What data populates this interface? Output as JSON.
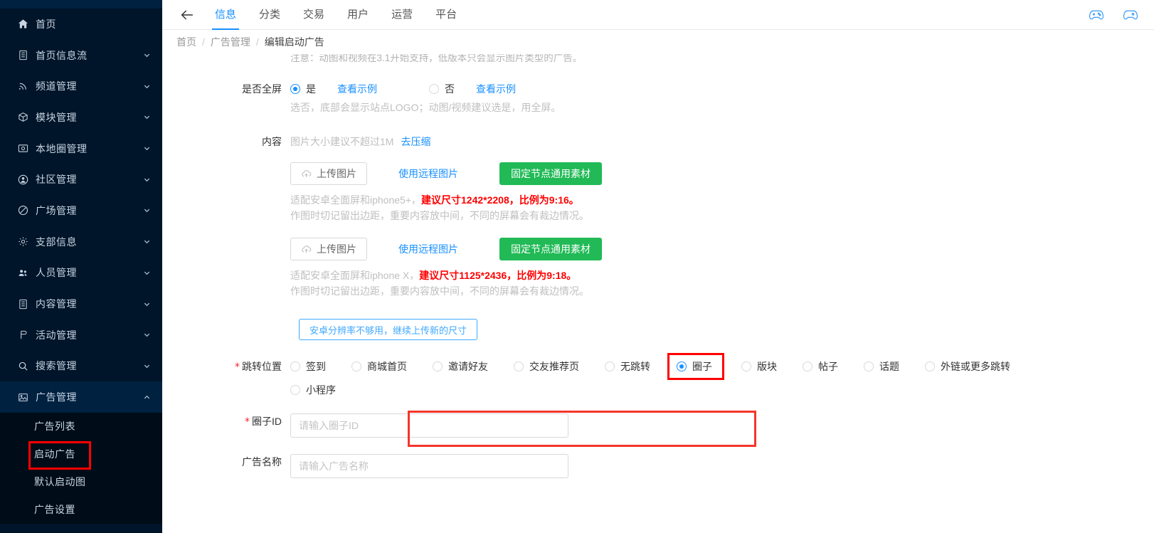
{
  "sidebar": {
    "items": [
      {
        "label": "首页",
        "icon": "home-icon",
        "arrow": false
      },
      {
        "label": "首页信息流",
        "icon": "feed-icon",
        "arrow": true
      },
      {
        "label": "频道管理",
        "icon": "rss-icon",
        "arrow": true
      },
      {
        "label": "模块管理",
        "icon": "cube-icon",
        "arrow": true
      },
      {
        "label": "本地圈管理",
        "icon": "card-icon",
        "arrow": true
      },
      {
        "label": "社区管理",
        "icon": "user-circle-icon",
        "arrow": true
      },
      {
        "label": "广场管理",
        "icon": "slash-circle-icon",
        "arrow": true
      },
      {
        "label": "支部信息",
        "icon": "gear-icon",
        "arrow": true
      },
      {
        "label": "人员管理",
        "icon": "people-icon",
        "arrow": true
      },
      {
        "label": "内容管理",
        "icon": "doc-icon",
        "arrow": true
      },
      {
        "label": "活动管理",
        "icon": "flag-icon",
        "arrow": true
      },
      {
        "label": "搜索管理",
        "icon": "search-icon",
        "arrow": true
      },
      {
        "label": "广告管理",
        "icon": "picture-icon",
        "arrow": true,
        "expanded": true
      }
    ],
    "submenu": [
      {
        "label": "广告列表",
        "highlighted": false
      },
      {
        "label": "启动广告",
        "highlighted": true
      },
      {
        "label": "默认启动图",
        "highlighted": false
      },
      {
        "label": "广告设置",
        "highlighted": false
      }
    ]
  },
  "topnav": {
    "back_icon": "back-arrow-icon",
    "tabs": [
      {
        "label": "信息",
        "active": true
      },
      {
        "label": "分类",
        "active": false
      },
      {
        "label": "交易",
        "active": false
      },
      {
        "label": "用户",
        "active": false
      },
      {
        "label": "运营",
        "active": false
      },
      {
        "label": "平台",
        "active": false
      }
    ],
    "right_icons": [
      "gamepad-icon",
      "gamepad-alt-icon"
    ]
  },
  "breadcrumb": {
    "items": [
      "首页",
      "广告管理",
      "编辑启动广告"
    ],
    "separator": "/"
  },
  "form": {
    "top_note": "注意：动图和视频在3.1开始支持，低版本只会显示图片类型的广告。",
    "fullscreen": {
      "label": "是否全屏",
      "yes_label": "是",
      "yes_link": "查看示例",
      "no_label": "否",
      "no_link": "查看示例",
      "selected": "是",
      "hint": "选否，底部会显示站点LOGO；动图/视频建议选是，用全屏。"
    },
    "content": {
      "label": "内容",
      "size_hint": "图片大小建议不超过1M",
      "compress_link": "去压缩"
    },
    "upload_blocks": [
      {
        "upload_label": "上传图片",
        "remote_link": "使用远程图片",
        "material_button": "固定节点通用素材",
        "hint_prefix": "适配安卓全面屏和iphone5+，",
        "hint_red": "建议尺寸1242*2208，比例为9:16。",
        "hint_second": "作图时切记留出边距，重要内容放中间，不同的屏幕会有裁边情况。"
      },
      {
        "upload_label": "上传图片",
        "remote_link": "使用远程图片",
        "material_button": "固定节点通用素材",
        "hint_prefix": "适配安卓全面屏和iphone X，",
        "hint_red": "建议尺寸1125*2436，比例为9:18。",
        "hint_second": "作图时切记留出边距，重要内容放中间，不同的屏幕会有裁边情况。"
      }
    ],
    "add_resolution_button": "安卓分辨率不够用，继续上传新的尺寸",
    "jump": {
      "label": "跳转位置",
      "required": true,
      "options_row1": [
        {
          "label": "签到",
          "checked": false
        },
        {
          "label": "商城首页",
          "checked": false
        },
        {
          "label": "邀请好友",
          "checked": false
        },
        {
          "label": "交友推荐页",
          "checked": false
        },
        {
          "label": "无跳转",
          "checked": false
        },
        {
          "label": "圈子",
          "checked": true,
          "highlighted": true
        },
        {
          "label": "版块",
          "checked": false
        },
        {
          "label": "帖子",
          "checked": false
        },
        {
          "label": "话题",
          "checked": false
        },
        {
          "label": "外链或更多跳转",
          "checked": false
        }
      ],
      "options_row2": [
        {
          "label": "小程序",
          "checked": false
        }
      ]
    },
    "circle_id": {
      "label": "圈子ID",
      "required": true,
      "placeholder": "请输入圈子ID",
      "value": "",
      "highlighted": true
    },
    "ad_name": {
      "label": "广告名称",
      "required": false,
      "placeholder": "请输入广告名称",
      "value": ""
    }
  },
  "colors": {
    "sidebar_bg": "#001529",
    "submenu_bg": "#000c17",
    "accent_blue": "#1890ff",
    "green_button": "#21ba56",
    "highlight_red": "#ff0000"
  }
}
